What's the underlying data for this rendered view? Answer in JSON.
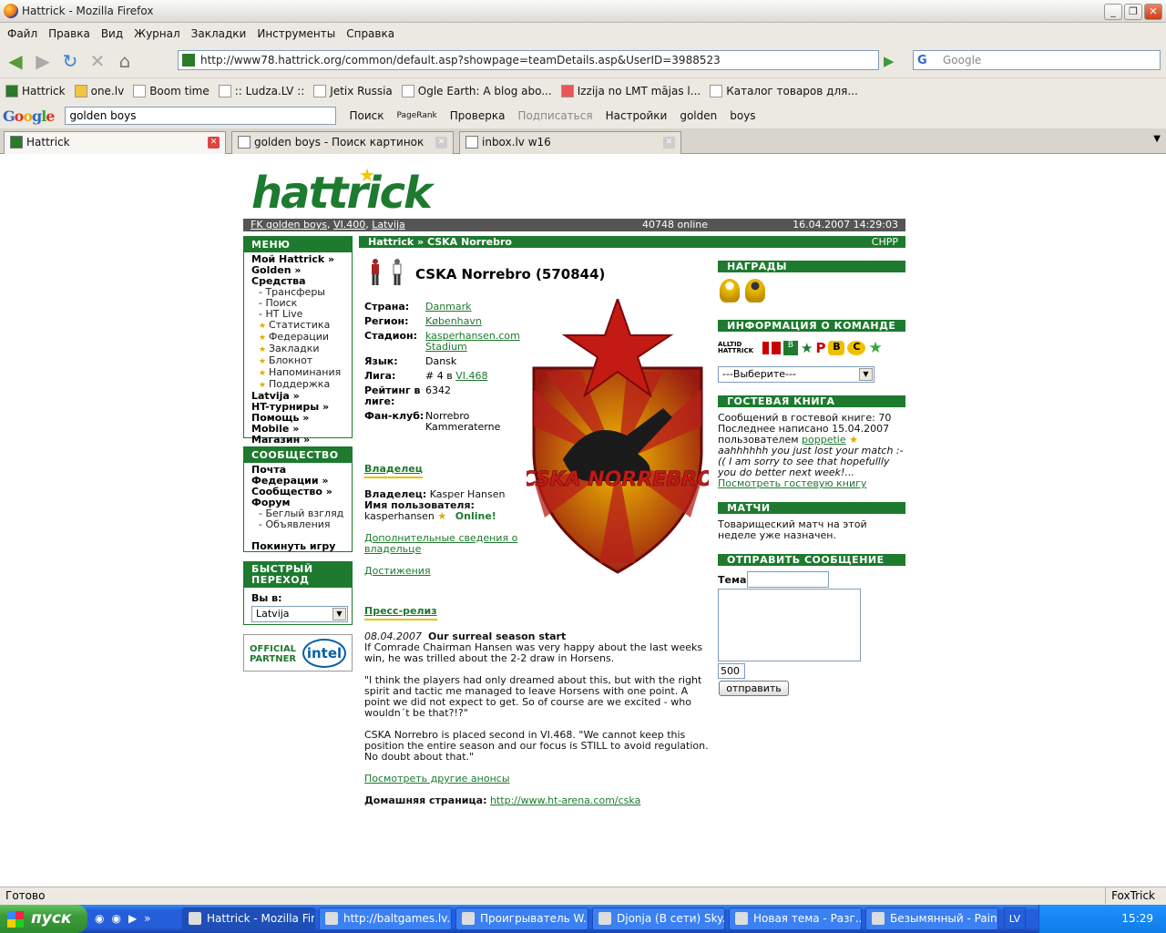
{
  "window": {
    "title": "Hattrick - Mozilla Firefox"
  },
  "menu": [
    "Файл",
    "Правка",
    "Вид",
    "Журнал",
    "Закладки",
    "Инструменты",
    "Справка"
  ],
  "nav": {
    "url": "http://www78.hattrick.org/common/default.asp?showpage=teamDetails.asp&UserID=3988523",
    "search_placeholder": "Google"
  },
  "bookmarks": [
    "Hattrick",
    "one.lv",
    "Boom time",
    ":: Ludza.LV ::",
    "Jetix Russia",
    "Ogle Earth: A blog abo...",
    "Izzija no LMT mājas l...",
    "Каталог товаров для..."
  ],
  "gtoolbar": {
    "query": "golden boys",
    "search": "Поиск",
    "pagerank": "PageRank",
    "check": "Проверка",
    "subscribe": "Подписаться",
    "settings": "Настройки",
    "w1": "golden",
    "w2": "boys"
  },
  "tabs": [
    {
      "label": "Hattrick"
    },
    {
      "label": "golden boys - Поиск картинок Google"
    },
    {
      "label": "inbox.lv w16"
    }
  ],
  "site": {
    "logo": "hattrick",
    "strip": {
      "team": "FK golden boys",
      "league": "VI.400",
      "country": "Latvija",
      "online": "40748 online",
      "date": "16.04.2007  14:29:03"
    },
    "menu_title": "МЕНЮ",
    "menu_items": [
      {
        "t": "Мой Hattrick »",
        "lvl": 0
      },
      {
        "t": "Golden »",
        "lvl": 0
      },
      {
        "t": "Средства",
        "lvl": 0
      },
      {
        "t": "- Трансферы",
        "lvl": 1
      },
      {
        "t": "- Поиск",
        "lvl": 1
      },
      {
        "t": "- HT Live",
        "lvl": 1
      },
      {
        "t": "Статистика",
        "lvl": 2
      },
      {
        "t": "Федерации",
        "lvl": 2
      },
      {
        "t": "Закладки",
        "lvl": 2
      },
      {
        "t": "Блокнот",
        "lvl": 2
      },
      {
        "t": "Напоминания",
        "lvl": 2
      },
      {
        "t": "Поддержка",
        "lvl": 2
      },
      {
        "t": "Latvija »",
        "lvl": 0
      },
      {
        "t": "HT-турниры »",
        "lvl": 0
      },
      {
        "t": "Помощь »",
        "lvl": 0
      },
      {
        "t": "Mobile »",
        "lvl": 0
      },
      {
        "t": "Магазин »",
        "lvl": 0
      }
    ],
    "community_title": "СООБЩЕСТВО",
    "community_items": [
      {
        "t": "Почта",
        "lvl": 0
      },
      {
        "t": "Федерации »",
        "lvl": 0
      },
      {
        "t": "Сообщество »",
        "lvl": 0
      },
      {
        "t": "Форум",
        "lvl": 0
      },
      {
        "t": "- Беглый взгляд",
        "lvl": 1
      },
      {
        "t": "- Объявления",
        "lvl": 1
      },
      {
        "t": "",
        "lvl": 0
      },
      {
        "t": "Покинуть игру",
        "lvl": 0
      }
    ],
    "quick_title": "БЫСТРЫЙ ПЕРЕХОД",
    "quick_label": "Вы в:",
    "quick_value": "Latvija",
    "partner": {
      "label1": "OFFICIAL",
      "label2": "PARTNER",
      "brand": "intel"
    },
    "breadcrumb": {
      "home": "Hattrick",
      "sep": " » ",
      "current": "CSKA Norrebro",
      "chpp": "CHPP"
    },
    "team_name": "CSKA Norrebro (570844)",
    "info": [
      {
        "k": "Страна:",
        "v": "Danmark",
        "link": true
      },
      {
        "k": "Регион:",
        "v": "København",
        "link": true
      },
      {
        "k": "Стадион:",
        "v": "kasperhansen.com Stadium",
        "link": true
      },
      {
        "k": "Язык:",
        "v": "Dansk",
        "link": false
      },
      {
        "k": "Лига:",
        "v": "# 4 в ",
        "v2": "VI.468",
        "link": false
      },
      {
        "k": "Рейтинг в лиге:",
        "v": "6342",
        "link": false
      },
      {
        "k": "Фан-клуб:",
        "v": "Norrebro Kammeraterne",
        "link": false
      }
    ],
    "crest_text": "CSKA NORREBRO",
    "owner": {
      "title": "Владелец",
      "owner_label": "Владелец:",
      "owner_name": "Kasper Hansen",
      "user_label": "Имя пользователя:",
      "user_name": "kasperhansen",
      "online": "Online!",
      "more": "Дополнительные сведения о владельце",
      "achievements": "Достижения"
    },
    "press": {
      "title": "Пресс-релиз",
      "date": "08.04.2007",
      "headline": "Our surreal season start",
      "p1": "If Comrade Chairman Hansen was very happy about the last weeks win, he was trilled about the 2-2 draw in Horsens.",
      "p2": "\"I think the players had only dreamed about this, but with the right spirit and tactic me managed to leave Horsens with one point. A point we did not expect to get. So of course are we excited - who wouldn´t be that?!?\"",
      "p3": "CSKA Norrebro is placed second in VI.468. \"We cannot keep this position the entire season and our focus is STILL to avoid regulation. No doubt about that.\"",
      "more": "Посмотреть другие анонсы",
      "home_label": "Домашняя страница:",
      "home_url": "http://www.ht-arena.com/cska"
    },
    "right": {
      "awards": "НАГРАДЫ",
      "teaminfo": "ИНФОРМАЦИЯ О КОМАНДЕ",
      "alltid": "ALLTID HATTRICK",
      "select": "---Выберите---",
      "guest": "ГОСТЕВАЯ КНИГА",
      "g1": "Сообщений в гостевой книге: 70",
      "g2": "Последнее написано 15.04.2007",
      "g3": "пользователем ",
      "g3u": "poppetie",
      "g4": "aahhhhhh you just lost your match :-(( I am sorry to see that hopefullly you do better next week!...",
      "g5": "Посмотреть гостевую книгу",
      "matches": "МАТЧИ",
      "m1": "Товарищеский матч на этой неделе уже назначен.",
      "send": "ОТПРАВИТЬ СООБЩЕНИЕ",
      "subject": "Тема",
      "counter": "500",
      "btn": "отправить"
    }
  },
  "status": {
    "left": "Готово",
    "right": "FoxTrick"
  },
  "taskbar": {
    "start": "пуск",
    "items": [
      "Hattrick - Mozilla Fir...",
      "http://baltgames.lv....",
      "Проигрыватель W...",
      "Djonja (В сети) Sky...",
      "Новая тема - Разг...",
      "Безымянный - Paint"
    ],
    "lv": "LV",
    "clock": "15:29"
  }
}
